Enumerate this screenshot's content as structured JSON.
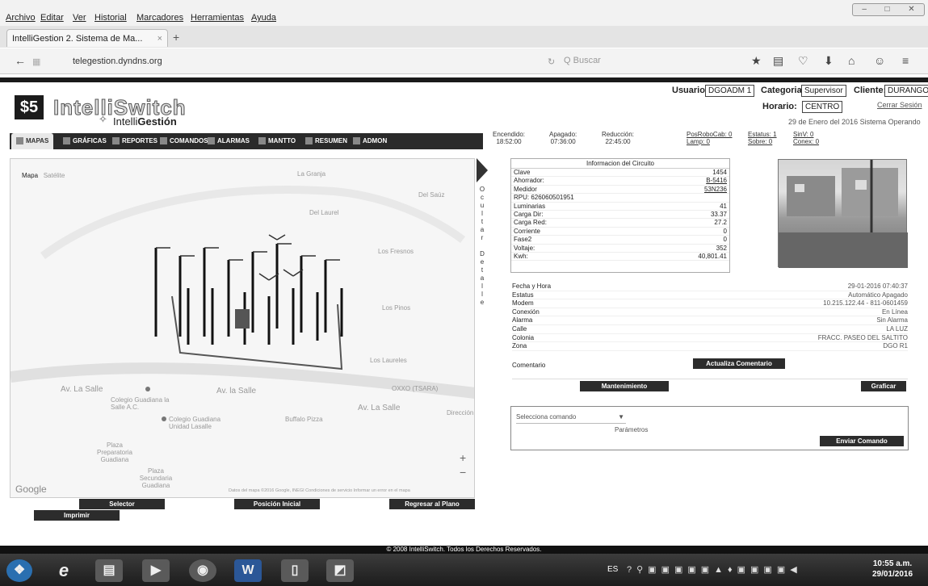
{
  "browser": {
    "menu": [
      "Archivo",
      "Editar",
      "Ver",
      "Historial",
      "Marcadores",
      "Herramientas",
      "Ayuda"
    ],
    "tab_title": "IntelliGestion 2. Sistema de Ma...",
    "tab_close": "×",
    "new_tab": "+",
    "url": "telegestion.dyndns.org",
    "search_placeholder": "Q Buscar",
    "win_controls": [
      "–",
      "□",
      "✕"
    ]
  },
  "app": {
    "logo_mark": "$5",
    "logo_name": "IntelliSwitch",
    "logo_sub_prefix": "Intelli",
    "logo_sub_bold": "Gestión",
    "usuario_label": "Usuario:",
    "usuario_value": "DGOADM 1",
    "categoria_label": "Categoria:",
    "categoria_value": "Supervisor",
    "cliente_label": "Cliente:",
    "cliente_value": "DURANGO",
    "horario_label": "Horario:",
    "horario_value": "CENTRO",
    "logout": "Cerrar Sesión",
    "date_status": "29 de Enero del 2016   Sistema Operando"
  },
  "nav": [
    {
      "label": "MAPAS"
    },
    {
      "label": "GRÁFICAS"
    },
    {
      "label": "REPORTES"
    },
    {
      "label": "COMANDOS"
    },
    {
      "label": "ALARMAS"
    },
    {
      "label": "MANTTO"
    },
    {
      "label": "RESUMEN"
    },
    {
      "label": "ADMON"
    }
  ],
  "schedule": {
    "encendido_label": "Encendido:",
    "encendido": "18:52:00",
    "apagado_label": "Apagado:",
    "apagado": "07:36:00",
    "reduccion_label": "Reducción:",
    "reduccion": "22:45:00"
  },
  "status_links": {
    "pos": "PosRoboCab: 0",
    "lamp": "Lamp: 0",
    "estatus": "Estatus: 1",
    "sobre": "Sobre: 0",
    "sinv": "SinV: 0",
    "conex": "Conex: 0"
  },
  "map": {
    "type_map": "Mapa",
    "type_sat": "Satélite",
    "google": "Google",
    "attribution": "Datos del mapa ©2016 Google, INEGI   Condiciones de servicio   Informar un error en el mapa",
    "streets": [
      "La Granja",
      "Del Saúz",
      "Del Laurel",
      "Los Fresnos",
      "Los Pinos",
      "Los Laureles",
      "Av. La Salle",
      "Av. la Salle",
      "Av. La Salle",
      "Colegio Guadiana la Salle A.C.",
      "Colegio Guadiana Unidad Lasalle",
      "Plaza Preparatoria Guadiana",
      "Plaza Secundaria Guadiana",
      "Buffalo Pizza",
      "OXXO (TSARA)",
      "Dirección"
    ],
    "zoom_in": "+",
    "zoom_out": "−"
  },
  "hide_label": [
    "O",
    "c",
    "u",
    "l",
    "t",
    "a",
    "r",
    "",
    "D",
    "e",
    "t",
    "a",
    "l",
    "l",
    "e"
  ],
  "map_buttons": {
    "selector": "Selector",
    "pos_inicial": "Posición Inicial",
    "regresar": "Regresar al Plano",
    "imprimir": "Imprimir"
  },
  "circuit": {
    "title": "Informacion del Circuito",
    "rows": [
      {
        "k": "Clave",
        "v": "1454"
      },
      {
        "k": "Ahorrador:",
        "v": "B-5416"
      },
      {
        "k": "Medidor",
        "v": "53N236"
      },
      {
        "k": "RPU: 626060501951",
        "v": ""
      },
      {
        "k": "Luminarias",
        "v": "41"
      },
      {
        "k": "Carga Dir:",
        "v": "33.37"
      },
      {
        "k": "Carga Red:",
        "v": "27.2"
      },
      {
        "k": "Corriente",
        "v": "0"
      },
      {
        "k": "Fase2",
        "v": "0"
      },
      {
        "k": "Voltaje:",
        "v": "352"
      },
      {
        "k": "Kwh:",
        "v": "40,801.41"
      }
    ]
  },
  "details": [
    {
      "k": "Fecha y Hora",
      "v": "29-01-2016 07:40:37"
    },
    {
      "k": "Estatus",
      "v": "Automático Apagado"
    },
    {
      "k": "Modem",
      "v": "10.215.122.44 - 811-0601459"
    },
    {
      "k": "Conexión",
      "v": "En Línea"
    },
    {
      "k": "Alarma",
      "v": "Sin Alarma"
    },
    {
      "k": "Calle",
      "v": "LA LUZ"
    },
    {
      "k": "Colonia",
      "v": "FRACC. PASEO DEL SALTITO"
    },
    {
      "k": "Zona",
      "v": "DGO R1"
    }
  ],
  "comentario_label": "Comentario",
  "buttons": {
    "actualiza": "Actualiza Comentario",
    "mantenimiento": "Mantenimiento",
    "graficar": "Graficar",
    "enviar": "Enviar Comando"
  },
  "command": {
    "select": "Selecciona comando",
    "params": "Parámetros"
  },
  "footer": "© 2008 IntelliSwitch. Todos los Derechos Reservados.",
  "taskbar": {
    "lang": "ES",
    "time": "10:55 a.m.",
    "date": "29/01/2016"
  }
}
